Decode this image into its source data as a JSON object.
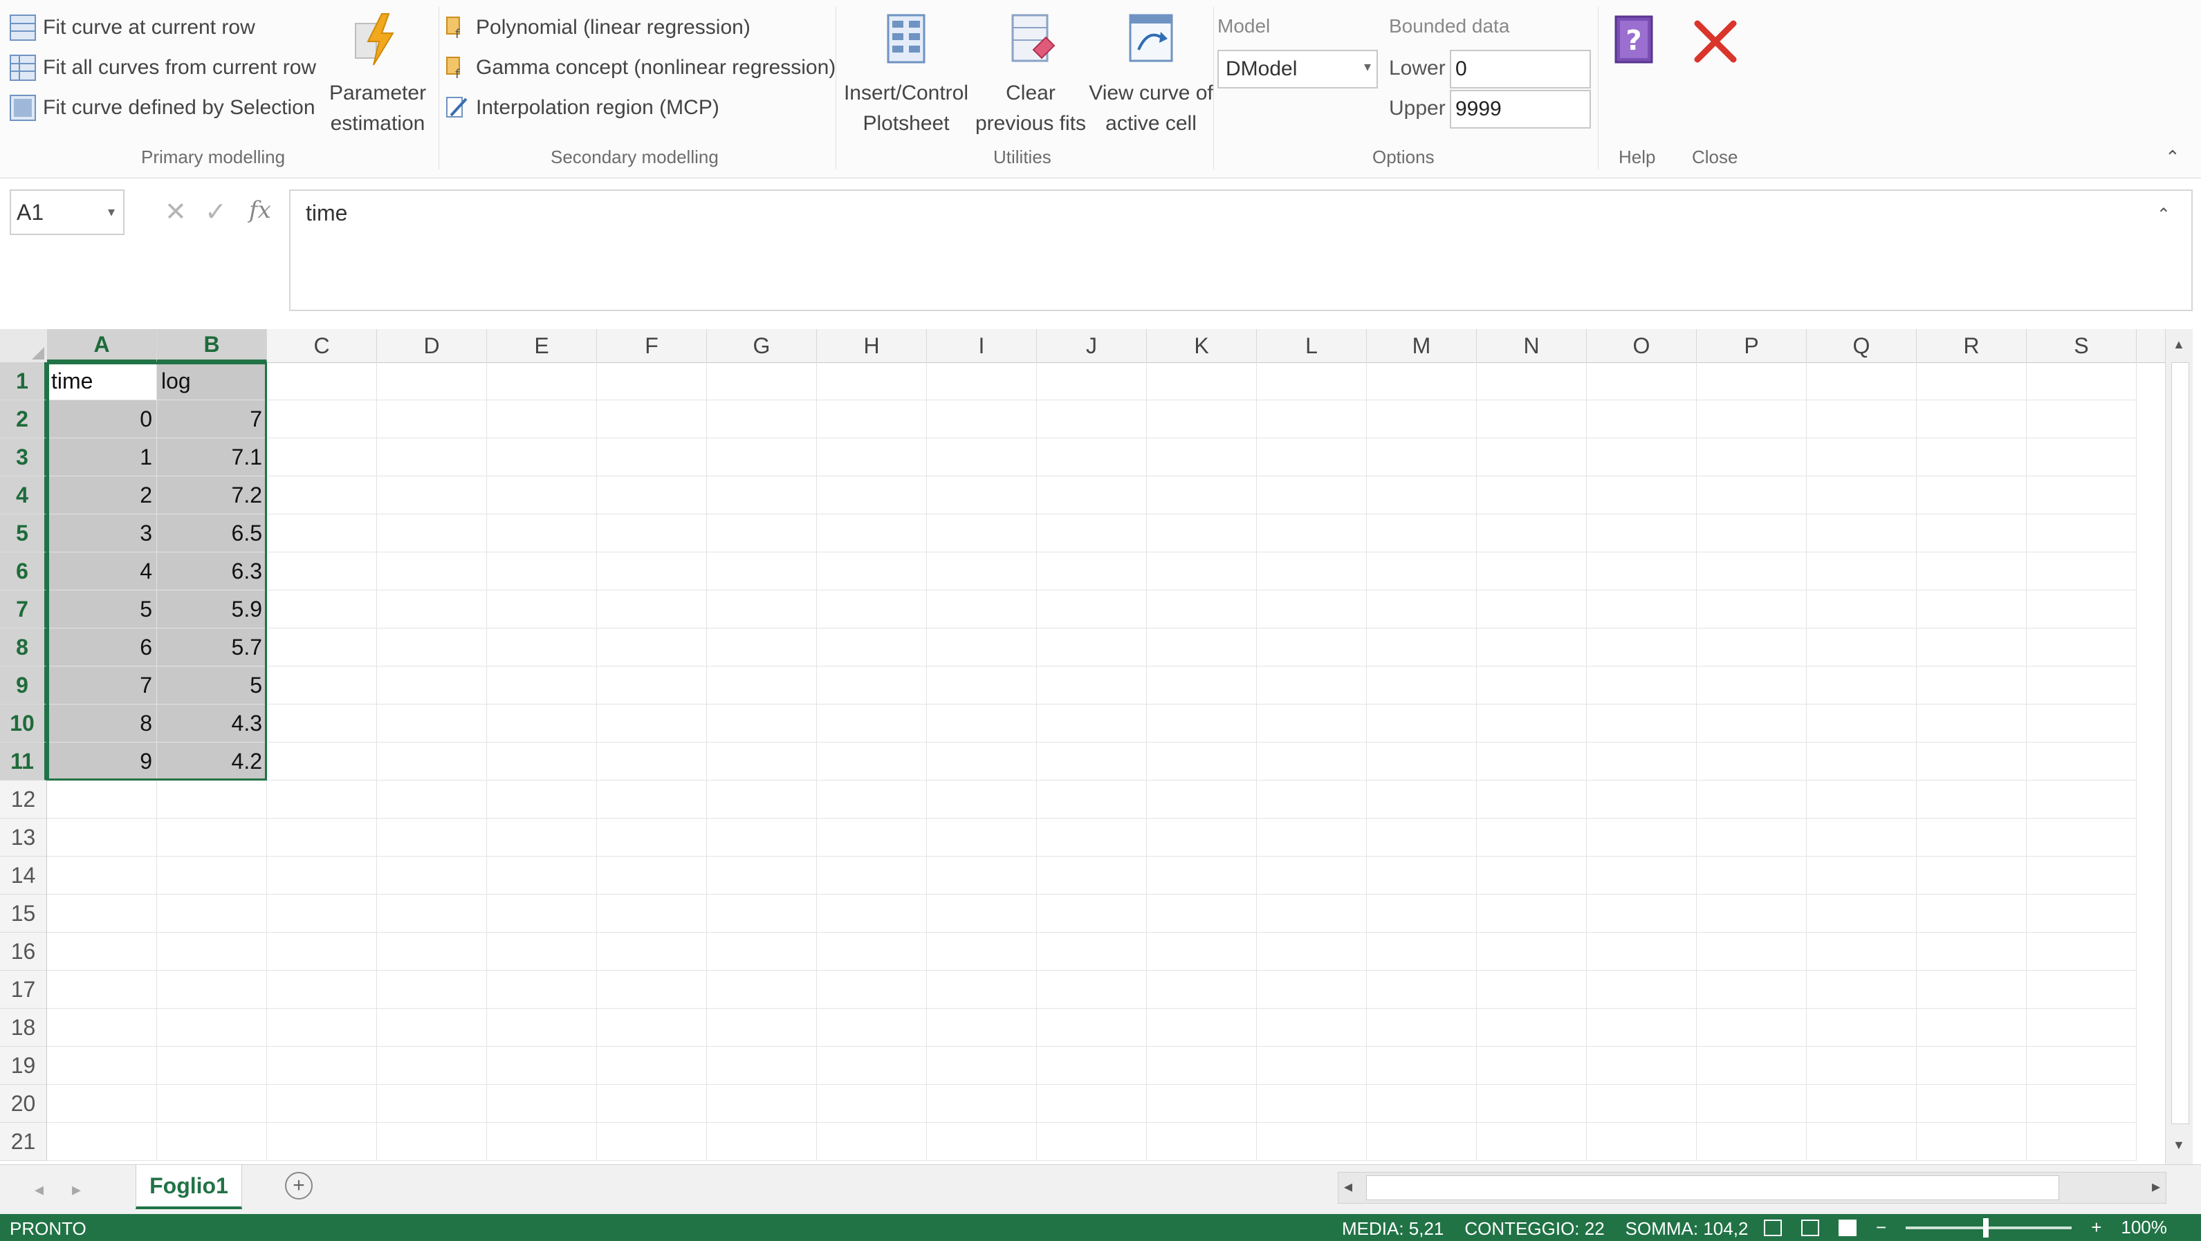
{
  "ribbon": {
    "primary": {
      "items": [
        {
          "label": "Fit curve at current row",
          "icon": "table-row-icon"
        },
        {
          "label": "Fit all curves from current row",
          "icon": "table-rows-icon"
        },
        {
          "label": "Fit curve defined by Selection",
          "icon": "table-selection-icon"
        }
      ],
      "param_label": "Parameter estimation",
      "group_label": "Primary modelling"
    },
    "secondary": {
      "items": [
        {
          "label": "Polynomial (linear regression)",
          "icon": "function-icon"
        },
        {
          "label": "Gamma concept (nonlinear regression)",
          "icon": "function-icon"
        },
        {
          "label": "Interpolation region (MCP)",
          "icon": "pencil-icon"
        }
      ],
      "group_label": "Secondary modelling"
    },
    "utilities": {
      "insert_label": "Insert/Control Plotsheet",
      "clear_label": "Clear previous fits",
      "view_label": "View curve of active cell",
      "group_label": "Utilities"
    },
    "options": {
      "model_label": "Model",
      "model_value": "DModel",
      "bounded_label": "Bounded data",
      "lower_label": "Lower",
      "lower_value": "0",
      "upper_label": "Upper",
      "upper_value": "9999",
      "group_label": "Options"
    },
    "help_label": "Help",
    "close_label": "Close"
  },
  "formula_bar": {
    "name_box": "A1",
    "content": "time",
    "fx": "fx"
  },
  "grid": {
    "columns": [
      "A",
      "B",
      "C",
      "D",
      "E",
      "F",
      "G",
      "H",
      "I",
      "J",
      "K",
      "L",
      "M",
      "N",
      "O",
      "P",
      "Q",
      "R",
      "S"
    ],
    "selected_columns": [
      "A",
      "B"
    ],
    "row_numbers": [
      "1",
      "2",
      "3",
      "4",
      "5",
      "6",
      "7",
      "8",
      "9",
      "10",
      "11",
      "12",
      "13",
      "14",
      "15",
      "16",
      "17",
      "18",
      "19",
      "20",
      "21"
    ],
    "selected_rows": 11,
    "cells": [
      [
        "time",
        "log"
      ],
      [
        "0",
        "7"
      ],
      [
        "1",
        "7.1"
      ],
      [
        "2",
        "7.2"
      ],
      [
        "3",
        "6.5"
      ],
      [
        "4",
        "6.3"
      ],
      [
        "5",
        "5.9"
      ],
      [
        "6",
        "5.7"
      ],
      [
        "7",
        "5"
      ],
      [
        "8",
        "4.3"
      ],
      [
        "9",
        "4.2"
      ]
    ]
  },
  "sheets": {
    "active": "Foglio1",
    "add_icon": "plus-circle-icon"
  },
  "status": {
    "ready": "PRONTO",
    "media": "MEDIA: 5,21",
    "conteggio": "CONTEGGIO: 22",
    "somma": "SOMMA: 104,2",
    "zoom": "100%"
  },
  "colors": {
    "excel_green": "#217346",
    "selection_fill": "#c8c8c8",
    "close_red": "#d9352b",
    "help_purple": "#7a4fb5"
  }
}
